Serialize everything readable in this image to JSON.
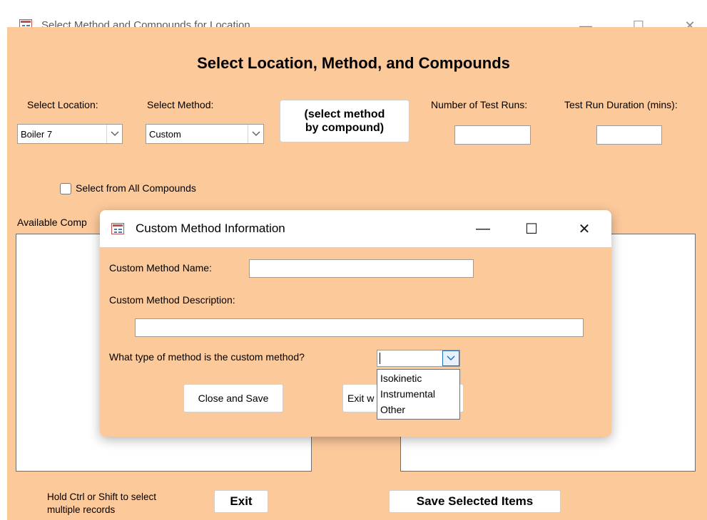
{
  "window": {
    "title": "Select Method and Compounds for Location",
    "minimize_glyph": "—",
    "maximize_glyph": "☐",
    "close_glyph": "✕"
  },
  "form": {
    "heading": "Select Location, Method, and Compounds",
    "location": {
      "label": "Select Location:",
      "value": "Boiler 7"
    },
    "method": {
      "label": "Select Method:",
      "value": "Custom"
    },
    "select_method_button": "(select method\nby compound)",
    "test_runs": {
      "label": "Number of Test Runs:",
      "value": ""
    },
    "test_duration": {
      "label": "Test Run Duration (mins):",
      "value": ""
    },
    "all_compounds_checkbox": {
      "label": "Select from  All Compounds",
      "checked": false
    },
    "available_label": "Available Comp",
    "hint": "Hold Ctrl or Shift to select\nmultiple records",
    "exit_button": "Exit",
    "save_button": "Save Selected Items"
  },
  "dialog": {
    "title": "Custom Method Information",
    "minimize_glyph": "—",
    "maximize_glyph": "☐",
    "close_glyph": "✕",
    "name_label": "Custom Method Name:",
    "name_value": "",
    "description_label": "Custom Method Description:",
    "description_value": "",
    "type_label": "What type of method is the custom method?",
    "type_value": "",
    "type_options": [
      "Isokinetic",
      "Instrumental",
      "Other"
    ],
    "close_save_button": "Close and Save",
    "exit_button": "Exit w"
  },
  "colors": {
    "form_background": "#fcc99b",
    "title_bar": "#ffffff",
    "accent_icon_red": "#c2504f",
    "accent_icon_blue": "#4a77b5",
    "combo_arrow_blue": "#1f6fc5"
  },
  "icons": {
    "app": "access-form-icon",
    "dropdown": "chevron-down-icon",
    "minimize": "minimize-icon",
    "maximize": "maximize-icon",
    "close": "close-icon"
  }
}
